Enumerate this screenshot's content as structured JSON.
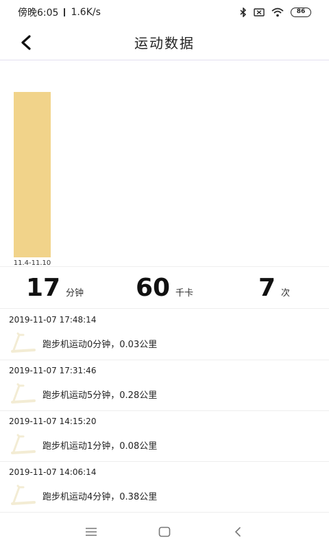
{
  "status_bar": {
    "time": "傍晚6:05",
    "net_speed": "1.6K/s",
    "battery": "86"
  },
  "header": {
    "title": "运动数据"
  },
  "chart_data": {
    "type": "bar",
    "categories": [
      "11.4-11.10"
    ],
    "values": [
      17
    ],
    "ylim": [
      0,
      17
    ],
    "grid": false,
    "bar_color": "#f1d38a"
  },
  "summary": {
    "minutes_value": "17",
    "minutes_unit": "分钟",
    "calories_value": "60",
    "calories_unit": "千卡",
    "count_value": "7",
    "count_unit": "次"
  },
  "records": [
    {
      "time": "2019-11-07 17:48:14",
      "desc": "跑步机运动0分钟，0.03公里"
    },
    {
      "time": "2019-11-07 17:31:46",
      "desc": "跑步机运动5分钟，0.28公里"
    },
    {
      "time": "2019-11-07 14:15:20",
      "desc": "跑步机运动1分钟，0.08公里"
    },
    {
      "time": "2019-11-07 14:06:14",
      "desc": "跑步机运动4分钟，0.38公里"
    }
  ],
  "colors": {
    "accent": "#f1d38a",
    "divider": "#eeeeee"
  }
}
